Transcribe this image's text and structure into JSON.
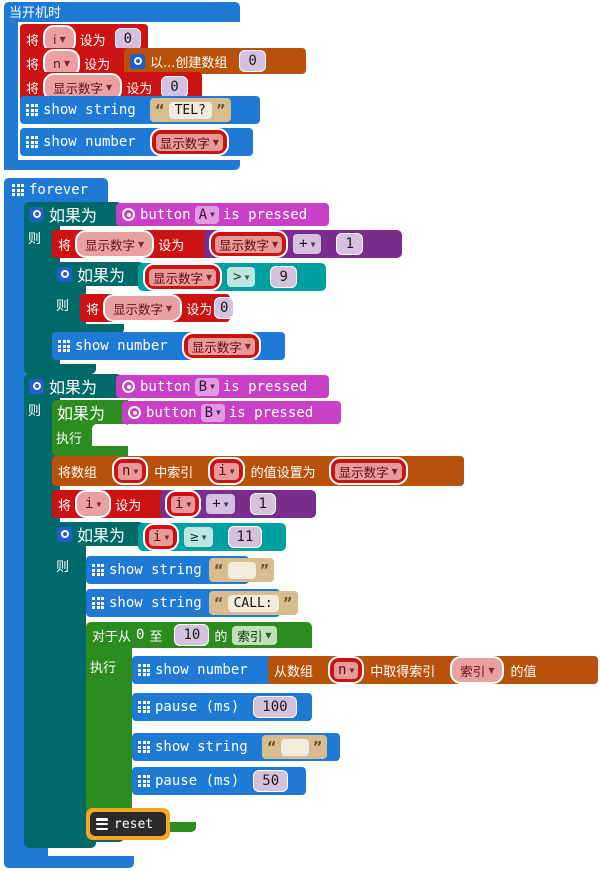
{
  "editor": {
    "name": "makecode-blocks-canvas",
    "background": "#ffffff"
  },
  "palette": {
    "event": "#1e7ad4",
    "basic": "#1e7ad4",
    "variable": "#cc1212",
    "logic_teal": "#006a6a",
    "logic_green": "#2d8c1f",
    "math": "#7b2d8e",
    "compare": "#00a0a0",
    "array": "#b8520a",
    "input": "#c83fc8",
    "loop": "#2d8c1f",
    "control": "#2b2b2b",
    "selection_outline": "#f5a623"
  },
  "on_start": {
    "hat_label": "当开机时",
    "set_i": {
      "verb": "将",
      "var": "i",
      "assign": "设为",
      "value": "0"
    },
    "set_n": {
      "verb": "将",
      "var": "n",
      "assign": "设为",
      "array_create_label": "以...创建数组",
      "array_arg": "0"
    },
    "set_display": {
      "verb": "将",
      "var": "显示数字",
      "assign": "设为",
      "value": "0"
    },
    "show_string": {
      "label": "show string",
      "text": "TEL?"
    },
    "show_number": {
      "label": "show number",
      "var": "显示数字"
    }
  },
  "forever": {
    "label": "forever",
    "if_a": {
      "if_label": "如果为",
      "then_label": "则",
      "condition": {
        "prefix": "button",
        "button": "A",
        "suffix": "is pressed"
      },
      "set_display": {
        "verb": "将",
        "var": "显示数字",
        "assign": "设为",
        "operand_left": "显示数字",
        "operator": "+",
        "operand_right": "1"
      },
      "inner_if": {
        "if_label": "如果为",
        "then_label": "则",
        "cmp_left": "显示数字",
        "cmp_op": ">",
        "cmp_right": "9",
        "body": {
          "verb": "将",
          "var": "显示数字",
          "assign": "设为",
          "value": "0"
        }
      },
      "show_number": {
        "label": "show number",
        "var": "显示数字"
      }
    },
    "if_b": {
      "if_label": "如果为",
      "then_label": "则",
      "condition": {
        "prefix": "button",
        "button": "B",
        "suffix": "is pressed"
      },
      "green_if": {
        "if_label": "如果为",
        "do_label": "执行",
        "condition": {
          "prefix": "button",
          "button": "B",
          "suffix": "is pressed"
        },
        "body": ""
      },
      "array_set": {
        "part1": "将数组",
        "array": "n",
        "part2": "中索引",
        "index": "i",
        "part3": "的值设置为",
        "value_var": "显示数字"
      },
      "set_i": {
        "verb": "将",
        "var": "i",
        "assign": "设为",
        "operand_left": "i",
        "operator": "+",
        "operand_right": "1"
      },
      "inner_if": {
        "if_label": "如果为",
        "then_label": "则",
        "cmp_left": "i",
        "cmp_op": "≥",
        "cmp_right": "11",
        "show_blank": {
          "label": "show string",
          "text": " "
        },
        "show_call": {
          "label": "show string",
          "text": "CALL:"
        },
        "for_loop": {
          "part1": "对于从",
          "from": "0",
          "part2": "至",
          "to": "10",
          "part3": "的",
          "index_var": "索引",
          "do_label": "执行",
          "show_number": {
            "label": "show number",
            "getter": {
              "part1": "从数组",
              "array": "n",
              "part2": "中取得索引",
              "index": "索引",
              "part3": "的值"
            }
          },
          "pause_100": {
            "label": "pause (ms)",
            "value": "100"
          },
          "show_blank": {
            "label": "show string",
            "text": " "
          },
          "pause_50": {
            "label": "pause (ms)",
            "value": "50"
          }
        },
        "reset": {
          "label": "reset",
          "selected": true
        }
      }
    }
  }
}
